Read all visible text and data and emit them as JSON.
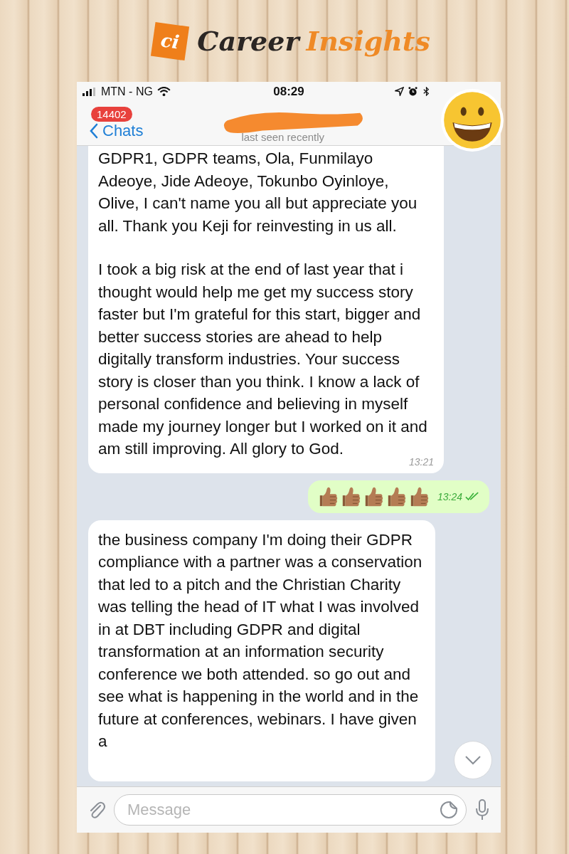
{
  "logo": {
    "mark": "ci",
    "words": [
      {
        "text": "Career",
        "color": "#2b2624"
      },
      {
        "text": "Insights",
        "color": "#ef8a26"
      }
    ]
  },
  "status_bar": {
    "carrier": "MTN - NG",
    "time": "08:29"
  },
  "nav": {
    "back_label": "Chats",
    "unread_badge": "14402",
    "subtitle": "last seen recently"
  },
  "messages": [
    {
      "outgoing": false,
      "kind": "text",
      "paragraphs": [
        "GDPR1, GDPR teams, Ola, Funmilayo Adeoye, Jide Adeoye,  Tokunbo Oyinloye, Olive, I can't name you all but appreciate you all. Thank you Keji for reinvesting in us all.",
        "I took a big risk at the end of last year that i thought would help me get my success story faster but I'm grateful for this start, bigger and better success stories are ahead to help digitally transform industries. Your success story is closer than you think. I know a lack of personal confidence and believing in myself made my journey longer but I worked on it and am still improving. All glory to God."
      ],
      "time": "13:21"
    },
    {
      "outgoing": true,
      "kind": "emoji",
      "time": "13:24",
      "read": true
    },
    {
      "outgoing": false,
      "kind": "text",
      "paragraphs": [
        "the business company I'm doing their GDPR compliance with a partner was a conservation that led to a pitch and the Christian Charity was telling the head of IT what  I was involved in at DBT including GDPR and digital transformation at  an information security conference we both attended. so go out and see what is happening in the world and in the future at conferences, webinars. I have given a"
      ]
    }
  ],
  "composer": {
    "placeholder": "Message"
  }
}
